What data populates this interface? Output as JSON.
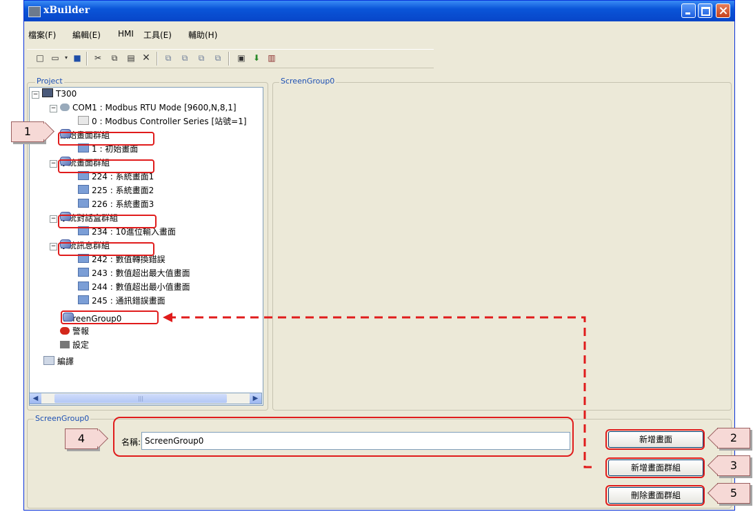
{
  "window": {
    "title": "xBuilder"
  },
  "menu": [
    "檔案(F)",
    "編輯(E)",
    "HMI",
    "工具(E)",
    "輔助(H)"
  ],
  "toolbar_icons": [
    "new-icon",
    "open-icon",
    "dropdown-icon",
    "save-icon",
    "cut-icon",
    "copy-icon",
    "paste-icon",
    "delete-icon",
    "tool1-icon",
    "tool2-icon",
    "tool3-icon",
    "tool4-icon",
    "compile-icon",
    "download-icon",
    "simulate-icon"
  ],
  "panels": {
    "project_label": "Project",
    "screengroup_label": "ScreenGroup0",
    "bottom_label": "ScreenGroup0"
  },
  "tree": {
    "root": "T300",
    "com": "COM1 : Modbus RTU Mode [9600,N,8,1]",
    "device": "0 : Modbus Controller Series [站號=1]",
    "groups": [
      {
        "label": "啟始畫面群組",
        "screens": [
          "1 : 初始畫面"
        ]
      },
      {
        "label": "系統畫面群組",
        "screens": [
          "224 : 系統畫面1",
          "225 : 系統畫面2",
          "226 : 系統畫面3"
        ]
      },
      {
        "label": "系統對話盒群組",
        "screens": [
          "234 : 10進位輸入畫面"
        ]
      },
      {
        "label": "系統訊息群組",
        "screens": [
          "242 : 數值轉換錯誤",
          "243 : 數值超出最大值畫面",
          "244 : 數值超出最小值畫面",
          "245 : 通訊錯誤畫面"
        ]
      }
    ],
    "new_group": "ScreenGroup0",
    "alarm": "警報",
    "settings": "設定",
    "compile": "編譯"
  },
  "form": {
    "name_label": "名稱:",
    "name_value": "ScreenGroup0"
  },
  "buttons": {
    "add_screen": "新增畫面",
    "add_group": "新增畫面群組",
    "delete_group": "刪除畫面群組"
  },
  "callouts": [
    "1",
    "2",
    "3",
    "4",
    "5"
  ],
  "colors": {
    "annotation": "#e01b1b",
    "titlebar": "#0a55d8"
  }
}
